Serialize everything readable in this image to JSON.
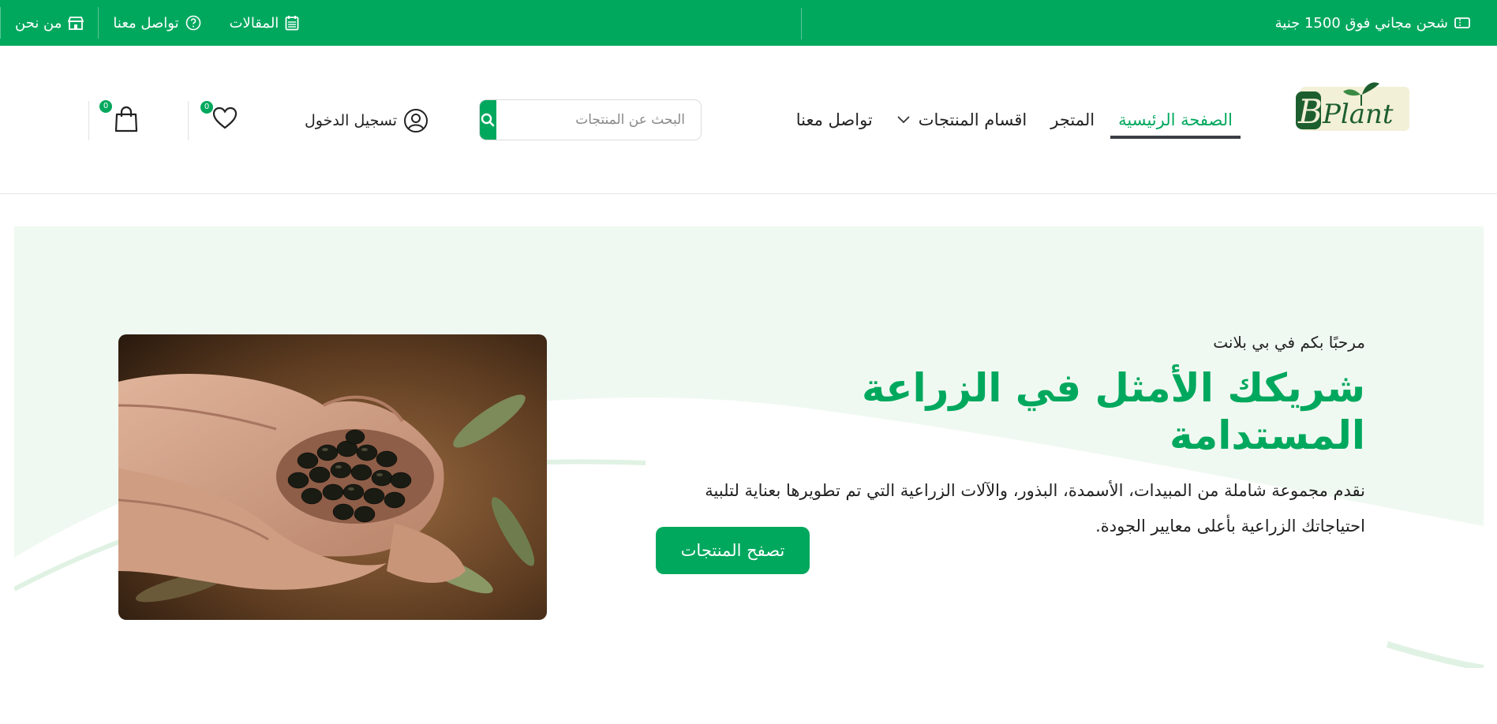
{
  "topbar": {
    "promo_text": "شحن مجاني فوق 1500 جنية",
    "promo_icon": "ticket-icon",
    "links": [
      {
        "label": "المقالات",
        "icon": "calendar-icon"
      },
      {
        "label": "تواصل معنا",
        "icon": "help-circle-icon"
      },
      {
        "label": "من نحن",
        "icon": "store-icon"
      }
    ]
  },
  "header": {
    "logo_text": "BPlant",
    "nav": [
      {
        "label": "الصفحة الرئيسية",
        "active": true
      },
      {
        "label": "المتجر",
        "active": false
      },
      {
        "label": "اقسام المنتجات",
        "active": false,
        "has_dropdown": true
      },
      {
        "label": "تواصل معنا",
        "active": false
      }
    ],
    "search": {
      "placeholder": "البحث عن المنتجات",
      "value": ""
    },
    "login_label": "تسجيل الدخول",
    "wishlist_count": "0",
    "cart_count": "0"
  },
  "hero": {
    "welcome": "مرحبًا بكم في بي بلانت",
    "headline": "شريكك الأمثل في الزراعة المستدامة",
    "description": "نقدم مجموعة شاملة من المبيدات، الأسمدة، البذور، والآلات الزراعية التي تم تطويرها بعناية لتلبية احتياجاتك الزراعية بأعلى معايير الجودة.",
    "cta_label": "تصفح المنتجات"
  },
  "colors": {
    "brand_green": "#00a85e",
    "hero_bg": "#f0f9f1",
    "active_underline": "#3b3e45"
  }
}
